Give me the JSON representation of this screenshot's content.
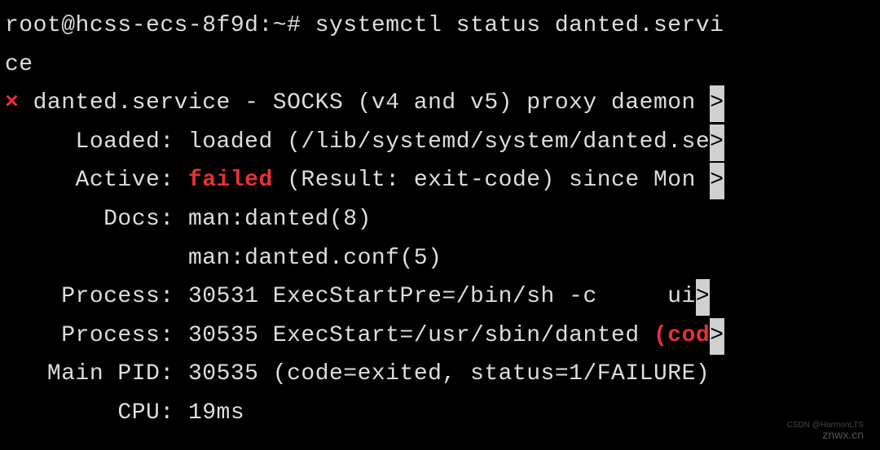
{
  "prompt": {
    "user_host": "root@hcss-ecs-8f9d",
    "cwd": "~",
    "symbol": "#",
    "command": "systemctl status danted.servi",
    "command_wrap": "ce"
  },
  "status": {
    "bullet": "×",
    "unit_line": "danted.service - SOCKS (v4 and v5) proxy daemon",
    "loaded_label": "Loaded:",
    "loaded_value": "loaded (/lib/systemd/system/danted.se",
    "active_label": "Active:",
    "active_status": "failed",
    "active_result": "(Result: exit-code) since Mon",
    "docs_label": "Docs:",
    "docs_line1": "man:danted(8)",
    "docs_line2": "man:danted.conf(5)",
    "process1_label": "Process:",
    "process1_pid": "30531",
    "process1_cmd": "ExecStartPre=/bin/sh -c     ui",
    "process2_label": "Process:",
    "process2_pid": "30535",
    "process2_cmd": "ExecStart=/usr/sbin/danted",
    "process2_code": "(cod",
    "mainpid_label": "Main PID:",
    "mainpid_value": "30535 (code=exited, status=1/FAILURE)",
    "cpu_label": "CPU:",
    "cpu_value": "19ms"
  },
  "marker": ">",
  "watermarks": {
    "w1": "CSDN @HarmonLTS",
    "w2": "znwx.cn"
  }
}
